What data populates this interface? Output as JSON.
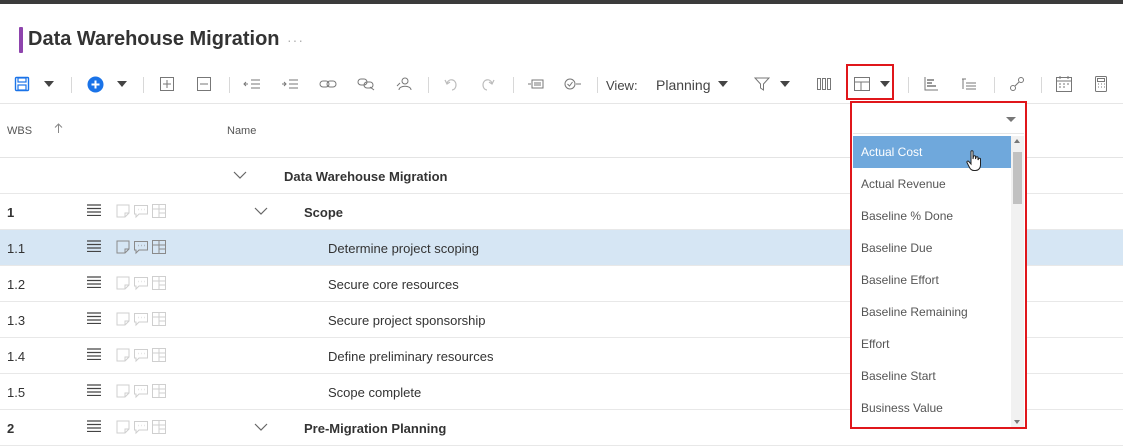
{
  "header": {
    "title": "Data Warehouse Migration",
    "more_label": "···"
  },
  "toolbar": {
    "view_label": "View:",
    "view_value": "Planning"
  },
  "columns": {
    "wbs": "WBS",
    "name": "Name",
    "sort_icon": "arrow-up-icon"
  },
  "rows": [
    {
      "wbs": "",
      "name": "Data Warehouse Migration",
      "bold": true
    },
    {
      "wbs": "1",
      "name": "Scope",
      "bold": true
    },
    {
      "wbs": "1.1",
      "name": "Determine project scoping",
      "selected": true
    },
    {
      "wbs": "1.2",
      "name": "Secure core resources"
    },
    {
      "wbs": "1.3",
      "name": "Secure project sponsorship"
    },
    {
      "wbs": "1.4",
      "name": "Define preliminary resources"
    },
    {
      "wbs": "1.5",
      "name": "Scope complete"
    },
    {
      "wbs": "2",
      "name": "Pre-Migration Planning",
      "bold": true
    }
  ],
  "dropdown": {
    "input_value": "",
    "items": [
      "Actual Cost",
      "Actual Revenue",
      "Baseline % Done",
      "Baseline Due",
      "Baseline Effort",
      "Baseline Remaining",
      "Effort",
      "Baseline Start",
      "Business Value"
    ],
    "active_index": 0
  },
  "colors": {
    "accent": "#8e44ad",
    "selected_row": "#d6e6f4",
    "highlight_box": "#e0161b",
    "active_item": "#6fa8dc",
    "add_button": "#1a73e8"
  }
}
